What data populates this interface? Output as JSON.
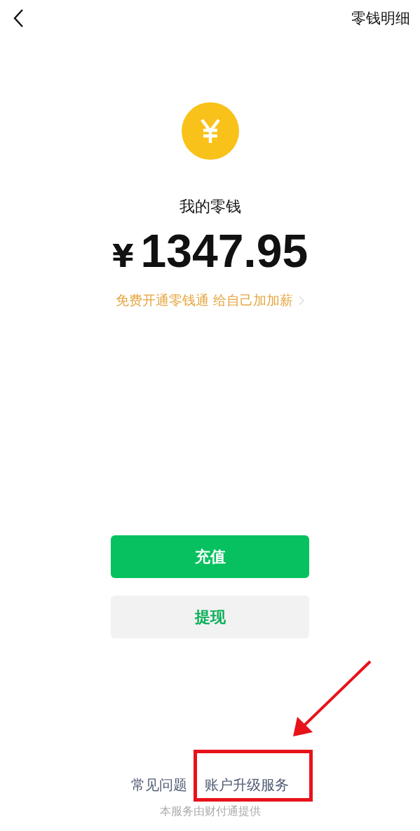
{
  "header": {
    "title": "零钱明细"
  },
  "balance": {
    "label": "我的零钱",
    "currency": "¥",
    "amount": "1347.95"
  },
  "promo": {
    "text": "免费开通零钱通 给自己加加薪"
  },
  "buttons": [
    {
      "label": "充值",
      "kind": "primary"
    },
    {
      "label": "提现",
      "kind": "secondary"
    }
  ],
  "footer": {
    "links": [
      "常见问题",
      "账户升级服务"
    ],
    "provider": "本服务由财付通提供"
  }
}
